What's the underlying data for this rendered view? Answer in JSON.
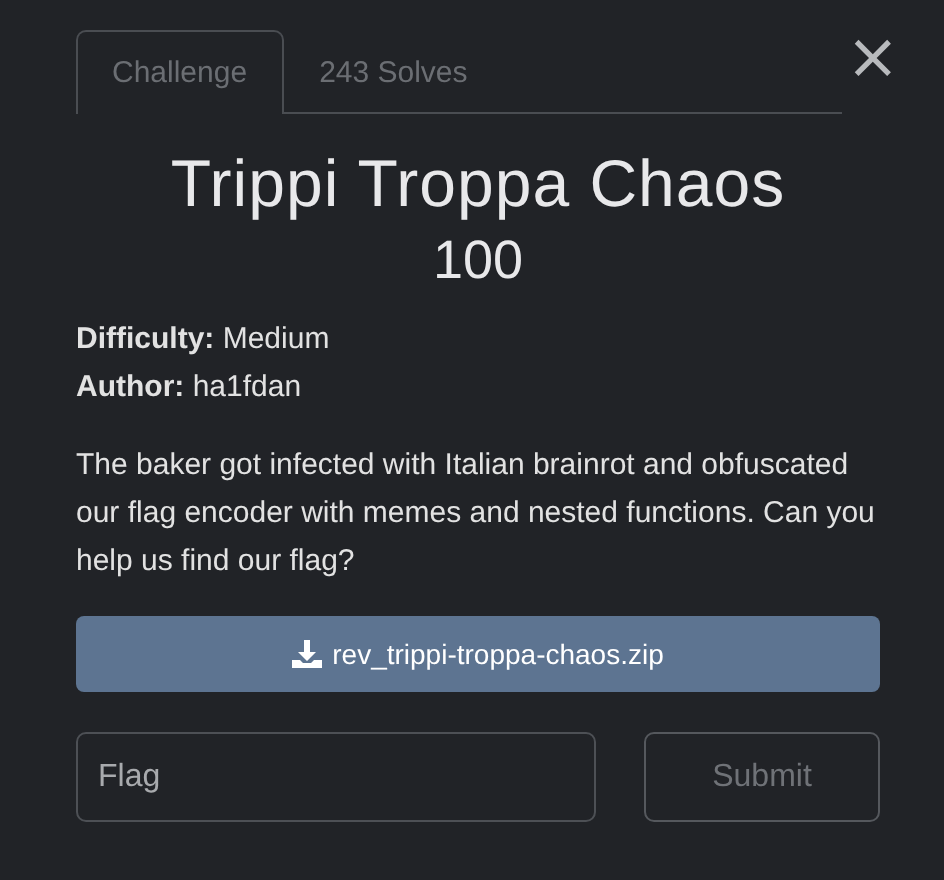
{
  "tabs": [
    {
      "label": "Challenge",
      "selected": true
    },
    {
      "label": "243 Solves",
      "selected": false
    }
  ],
  "close_button": {
    "label": "×"
  },
  "challenge": {
    "title": "Trippi Troppa Chaos",
    "points": "100",
    "info": [
      "**Difficulty:** Medium",
      "**Author:** ha1fdan"
    ],
    "description": "The baker got infected with Italian brainrot and obfuscated our flag encoder with memes and nested functions. Can you help us find our flag?",
    "file": {
      "label": "rev_trippi-troppa-chaos.zip"
    }
  },
  "flag_form": {
    "placeholder": "Flag",
    "submit": "Submit"
  }
}
